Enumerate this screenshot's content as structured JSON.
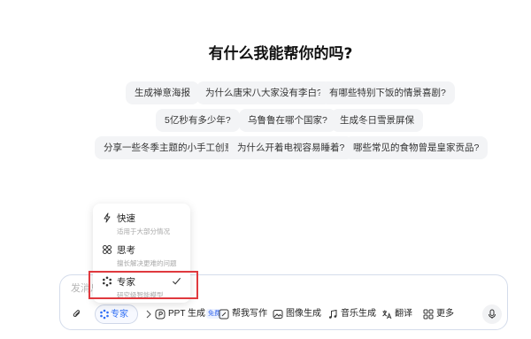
{
  "heading": "有什么我能帮你的吗?",
  "suggestions": [
    "生成禅意海报",
    "为什么唐宋八大家没有李白?",
    "有哪些特别下饭的情景喜剧?",
    "5亿秒有多少年?",
    "乌鲁鲁在哪个国家?",
    "生成冬日雪景屏保",
    "分享一些冬季主题的小手工创意",
    "为什么开着电视容易睡着?",
    "哪些常见的食物曾是皇家贡品?"
  ],
  "mode_menu": {
    "options": [
      {
        "label": "快速",
        "desc": "适用于大部分情况",
        "icon": "lightning-icon"
      },
      {
        "label": "思考",
        "desc": "擅长解决更难的问题",
        "icon": "think-icon"
      },
      {
        "label": "专家",
        "desc": "研究级智能模型",
        "icon": "expert-icon",
        "selected": true
      }
    ]
  },
  "composer": {
    "placeholder": "发消息",
    "mode_label": "专家",
    "toolbar": [
      {
        "label": "PPT 生成",
        "badge": "免费"
      },
      {
        "label": "帮我写作"
      },
      {
        "label": "图像生成"
      },
      {
        "label": "音乐生成"
      },
      {
        "label": "翻译"
      },
      {
        "label": "更多"
      }
    ]
  },
  "colors": {
    "accent": "#2f6ef5",
    "highlight": "#e0393e"
  }
}
